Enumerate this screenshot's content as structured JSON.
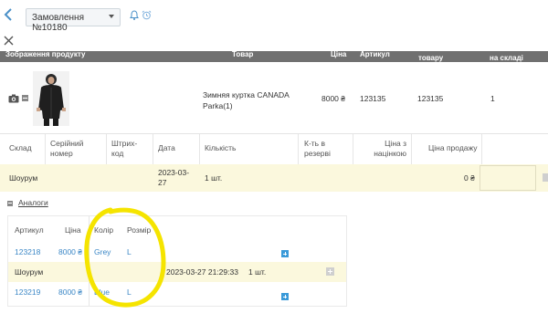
{
  "topbar": {
    "order_label": "Замовлення №10180",
    "icons": [
      "back-chevron-icon",
      "chevron-down-icon",
      "bell-icon",
      "alarm-clock-icon",
      "close-icon"
    ]
  },
  "header_strip": [
    "Зображення продукту",
    "Товар",
    "Ціна",
    "Артикул",
    "товару",
    "на складі"
  ],
  "product": {
    "name": "Зимняя куртка CANADA Parka(1)",
    "price": "8000 ₴",
    "article1": "123135",
    "article2": "123135",
    "stock": "1"
  },
  "grid": {
    "headers": [
      "Склад",
      "Серійний номер",
      "Штрих-код",
      "Дата",
      "Кількість",
      "К-ть в резерві",
      "Ціна з націнкою",
      "Ціна продажу"
    ],
    "row": {
      "warehouse": "Шоурум",
      "date": "2023-03-27",
      "qty": "1 шт.",
      "sale_price": "0 ₴"
    }
  },
  "analogs": {
    "label": "Аналоги",
    "headers": [
      "Артикул",
      "Ціна",
      "Колір",
      "Розмір"
    ],
    "rows": [
      {
        "article": "123218",
        "price": "8000 ₴",
        "color": "Grey",
        "size": "L"
      },
      {
        "article": "123219",
        "price": "8000 ₴",
        "color": "Blue",
        "size": "L"
      }
    ],
    "stock_row": {
      "warehouse": "Шоурум",
      "datetime": "2023-03-27 21:29:33",
      "qty": "1 шт."
    }
  },
  "colors": {
    "accent": "#3b87c6",
    "highlight_row": "#fbf8dd",
    "annotation": "#f5e400"
  }
}
